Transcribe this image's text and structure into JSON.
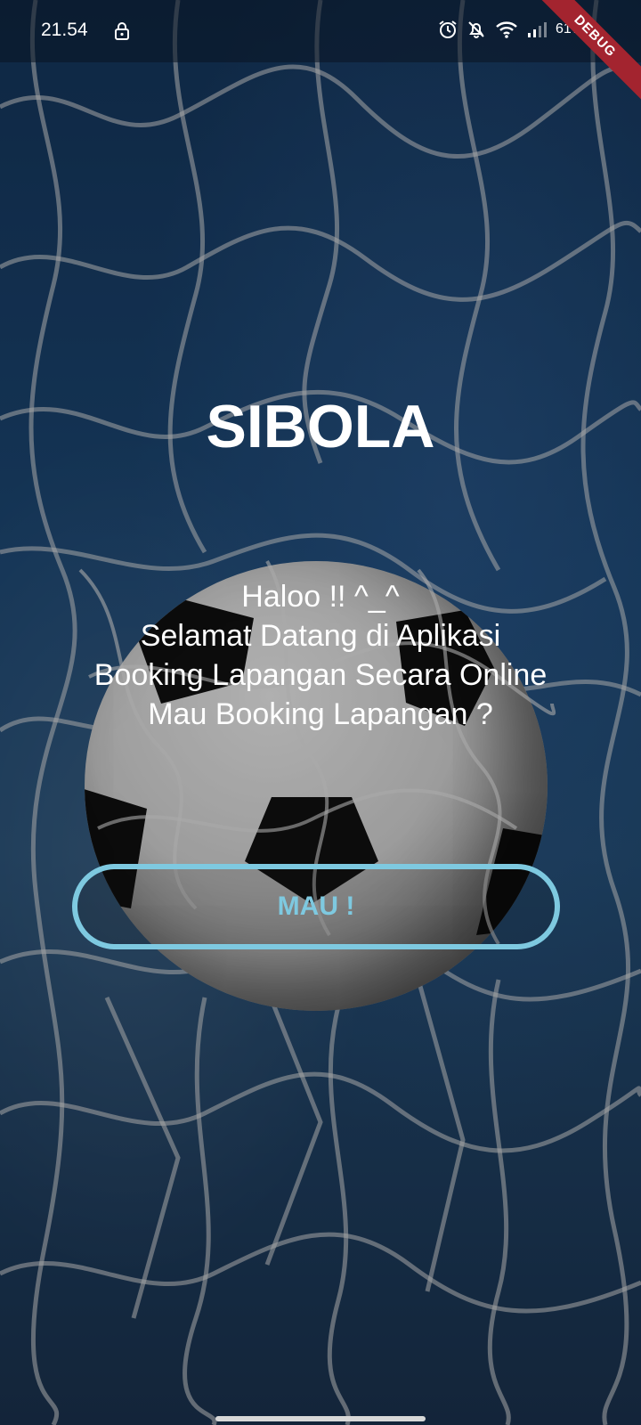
{
  "status_bar": {
    "time": "21.54",
    "battery": "61%",
    "icons": [
      "lock-icon",
      "alarm-icon",
      "bell-off-icon",
      "wifi-icon",
      "signal-icon"
    ]
  },
  "debug_banner": "DEBUG",
  "app": {
    "title": "SIBOLA",
    "message_lines": [
      "Haloo !! ^_^",
      "Selamat Datang di Aplikasi",
      "Booking Lapangan Secara Online",
      "Mau Booking Lapangan ?"
    ],
    "cta_label": "MAU !"
  },
  "colors": {
    "accent": "#7ec9e0",
    "text": "#ffffff",
    "debug": "#a3242f"
  }
}
